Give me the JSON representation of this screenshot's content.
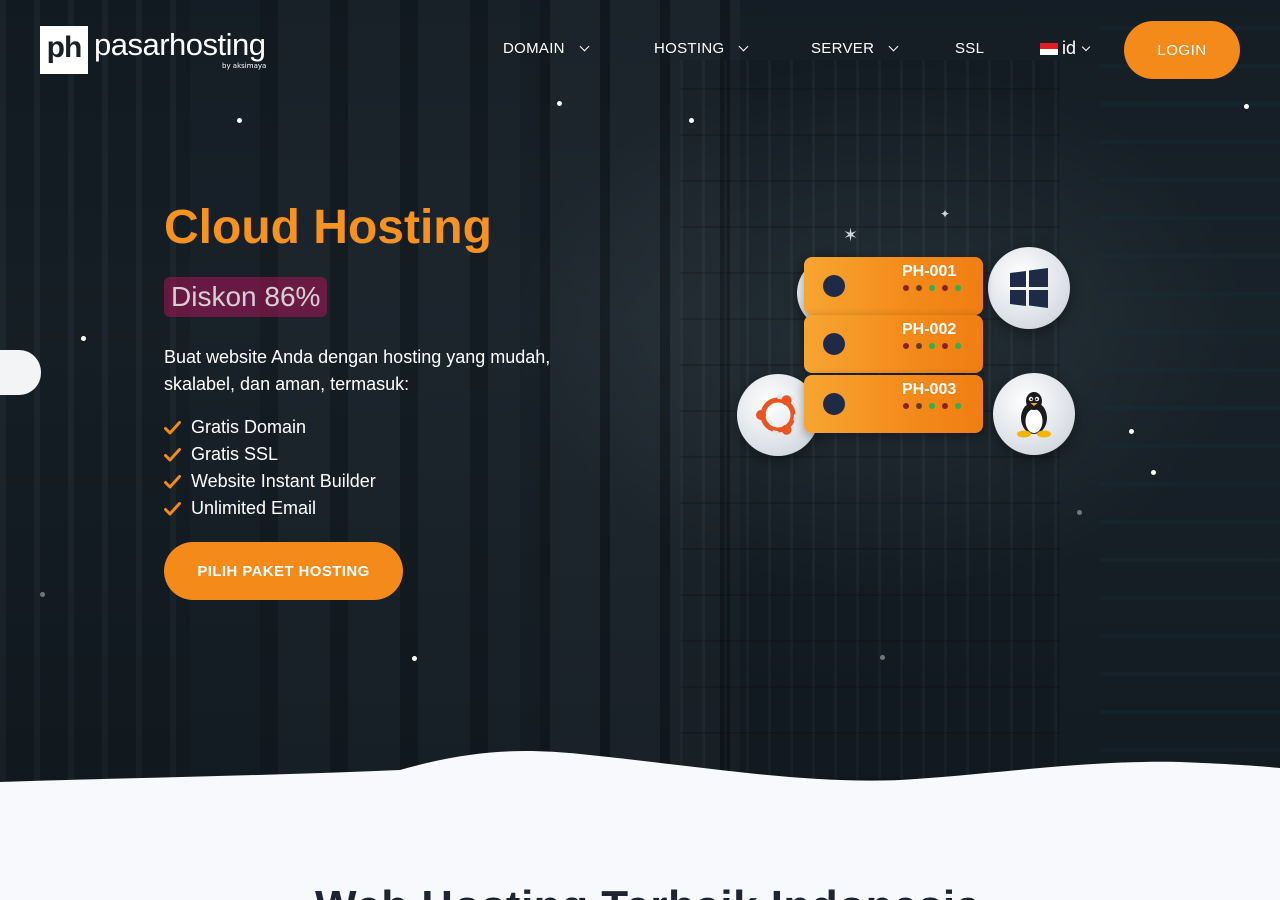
{
  "brand": {
    "logo_mark": "ph",
    "name": "pasarhosting",
    "tagline": "by aksimaya"
  },
  "nav": {
    "items": [
      {
        "label": "DOMAIN",
        "has_dropdown": true
      },
      {
        "label": "HOSTING",
        "has_dropdown": true
      },
      {
        "label": "SERVER",
        "has_dropdown": true
      },
      {
        "label": "SSL",
        "has_dropdown": false
      }
    ],
    "language": "id",
    "login_label": "LOGIN"
  },
  "hero": {
    "title": "Cloud Hosting",
    "promo": "Diskon 86%",
    "description": "Buat website Anda dengan hosting yang mudah, skalabel, dan aman, termasuk:",
    "features": [
      "Gratis Domain",
      "Gratis SSL",
      "Website Instant Builder",
      "Unlimited Email"
    ],
    "cta_label": "PILIH PAKET HOSTING"
  },
  "illustration": {
    "servers": [
      "PH-001",
      "PH-002",
      "PH-003"
    ],
    "os_icons": [
      "windows-icon",
      "ubuntu-icon",
      "linux-tux-icon"
    ]
  },
  "section_heading": "Web Hosting Terbaik Indonesia",
  "colors": {
    "accent": "#F38A1A",
    "title_orange": "#F59220",
    "navy": "#1F2B46",
    "page_bg": "#F7F9FC"
  }
}
